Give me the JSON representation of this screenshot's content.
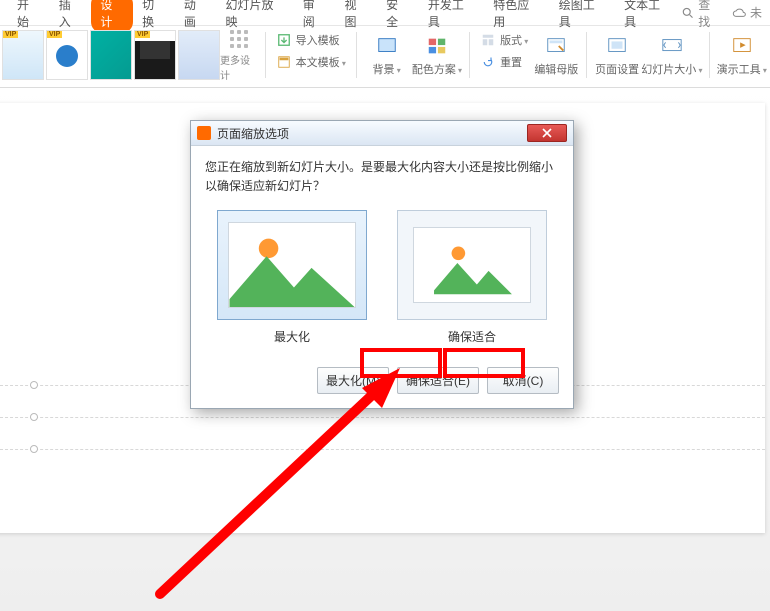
{
  "menu": {
    "items": [
      "开始",
      "插入",
      "设计",
      "切换",
      "动画",
      "幻灯片放映",
      "审阅",
      "视图",
      "安全",
      "开发工具",
      "特色应用",
      "绘图工具",
      "文本工具"
    ],
    "active_index": 2,
    "search_label": "查找",
    "cloud_label": "未"
  },
  "ribbon": {
    "more_designs": "更多设计",
    "import_template": "导入模板",
    "this_template": "本文模板",
    "background": "背景",
    "color_scheme": "配色方案",
    "layout": "版式",
    "reset": "重置",
    "edit_master": "编辑母版",
    "page_setup": "页面设置",
    "slide_size": "幻灯片大小",
    "presentation_tools": "演示工具"
  },
  "dialog": {
    "title": "页面缩放选项",
    "message": "您正在缩放到新幻灯片大小。是要最大化内容大小还是按比例缩小以确保适应新幻灯片？",
    "option_maximize": "最大化",
    "option_fit": "确保适合",
    "btn_maximize": "最大化(M)",
    "btn_fit": "确保适合(E)",
    "btn_cancel": "取消(C)"
  }
}
